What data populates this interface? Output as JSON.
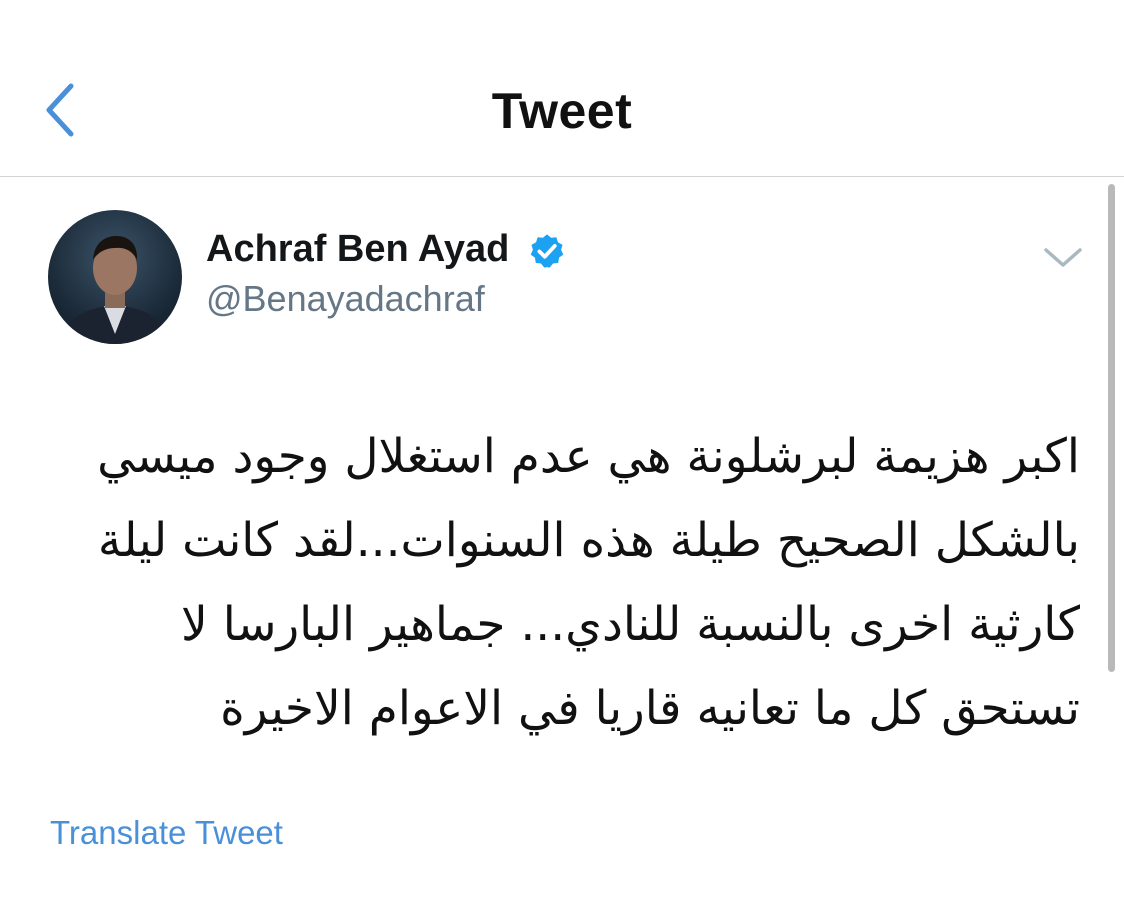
{
  "header": {
    "title": "Tweet",
    "back_icon": "chevron-left-icon"
  },
  "author": {
    "name": "Achraf Ben Ayad",
    "handle": "@Benayadachraf",
    "verified": true,
    "verified_icon": "verified-badge-icon",
    "avatar_icon": "profile-photo"
  },
  "tweet": {
    "text": "اكبر هزيمة لبرشلونة هي عدم استغلال وجود ميسي بالشكل الصحيح طيلة هذه السنوات...لقد كانت ليلة كارثية اخرى بالنسبة للنادي... جماهير البارسا لا تستحق كل ما تعانيه قاريا في الاعوام الاخيرة",
    "translate_label": "Translate Tweet",
    "menu_icon": "chevron-down-icon"
  },
  "colors": {
    "accent": "#1da1f2",
    "link": "#4a90d9",
    "secondary_text": "#657786",
    "divider": "#d3d3d3"
  }
}
